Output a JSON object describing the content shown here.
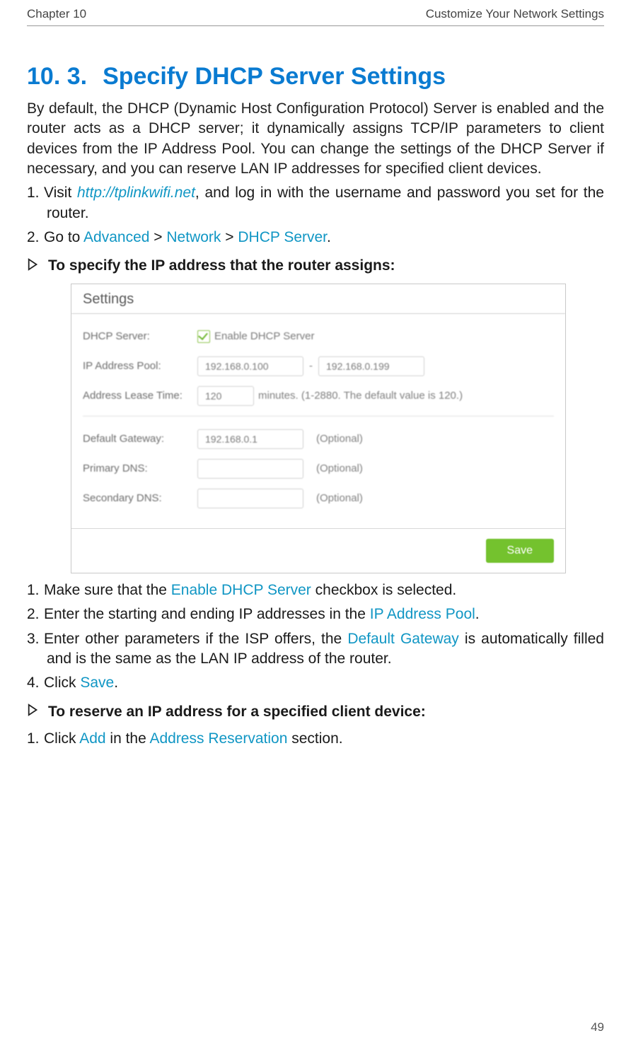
{
  "header": {
    "chapter": "Chapter 10",
    "section_title": "Customize Your Network Settings"
  },
  "title": {
    "num": "10. 3.",
    "text": "Specify DHCP Server Settings"
  },
  "intro": "By default, the DHCP (Dynamic Host Configuration Protocol) Server is enabled and the router acts as a DHCP server; it dynamically assigns TCP/IP parameters to client devices from the IP Address Pool. You can change the settings of the DHCP Server if necessary, and you can reserve LAN IP addresses for specified client devices.",
  "steps_initial": {
    "s1": {
      "num": "1.",
      "pre": "Visit ",
      "link": "http://tplinkwifi.net",
      "post": ", and log in with the username and password you set for the router."
    },
    "s2": {
      "num": "2.",
      "pre": "Go to ",
      "b1": "Advanced",
      "gt1": " > ",
      "b2": "Network",
      "gt2": " > ",
      "b3": "DHCP Server",
      "post": "."
    }
  },
  "chev1": "To specify the IP address that the router assigns:",
  "panel": {
    "heading": "Settings",
    "rows": {
      "dhcp": {
        "label": "DHCP Server:",
        "cklabel": "Enable DHCP Server"
      },
      "pool": {
        "label": "IP Address Pool:",
        "start": "192.168.0.100",
        "dash": "-",
        "end": "192.168.0.199"
      },
      "lease": {
        "label": "Address Lease Time:",
        "val": "120",
        "hint": "minutes. (1-2880. The default value is 120.)"
      },
      "gw": {
        "label": "Default Gateway:",
        "val": "192.168.0.1",
        "opt": "(Optional)"
      },
      "pdns": {
        "label": "Primary DNS:",
        "val": "",
        "opt": "(Optional)"
      },
      "sdns": {
        "label": "Secondary DNS:",
        "val": "",
        "opt": "(Optional)"
      }
    },
    "save": "Save"
  },
  "steps_after": {
    "s1": {
      "num": "1.",
      "pre": "Make sure that the ",
      "teal": "Enable DHCP Server",
      "post": " checkbox is selected."
    },
    "s2": {
      "num": "2.",
      "pre": "Enter the starting and ending IP addresses in the ",
      "teal": "IP Address Pool",
      "post": "."
    },
    "s3": {
      "num": "3.",
      "pre": "Enter other parameters if the ISP offers, the ",
      "teal": "Default Gateway",
      "post": " is automatically filled and is the same as the LAN IP address of the router."
    },
    "s4": {
      "num": "4.",
      "pre": "Click ",
      "teal": "Save",
      "post": "."
    }
  },
  "chev2": "To reserve an IP address for a specified client device:",
  "steps_reserve": {
    "s1": {
      "num": "1.",
      "pre": "Click ",
      "teal1": "Add",
      "mid": " in the ",
      "teal2": "Address Reservation",
      "post": " section."
    }
  },
  "page_number": "49"
}
